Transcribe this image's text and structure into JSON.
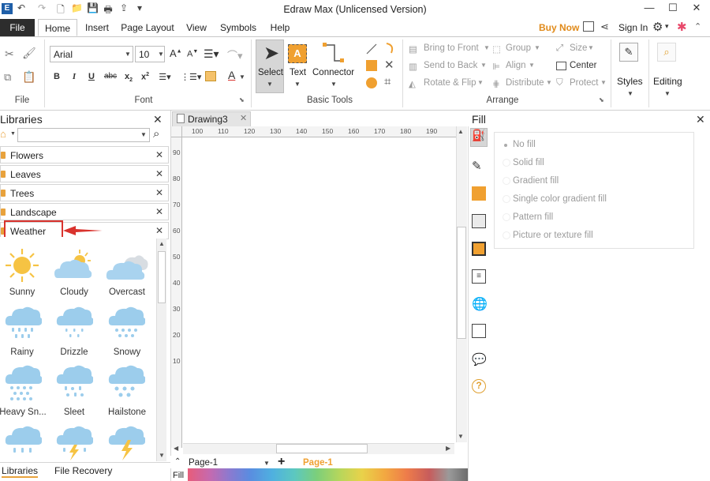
{
  "window": {
    "title": "Edraw Max (Unlicensed Version)",
    "minimize": "—",
    "maximize": "☐",
    "close": "✕"
  },
  "menu": {
    "file": "File",
    "tabs": [
      "Home",
      "Insert",
      "Page Layout",
      "View",
      "Symbols",
      "Help"
    ],
    "active_tab": "Home",
    "buy_now": "Buy Now",
    "sign_in": "Sign In"
  },
  "ribbon": {
    "groups": {
      "file": "File",
      "font": "Font",
      "basic_tools": "Basic Tools",
      "arrange": "Arrange"
    },
    "font_name": "Arial",
    "font_size": "10",
    "tools": {
      "select": "Select",
      "text": "Text",
      "connector": "Connector"
    },
    "arrange": {
      "bring_to_front": "Bring to Front",
      "send_to_back": "Send to Back",
      "rotate_flip": "Rotate & Flip",
      "group": "Group",
      "align": "Align",
      "distribute": "Distribute",
      "size": "Size",
      "center": "Center",
      "protect": "Protect"
    },
    "styles": "Styles",
    "editing": "Editing"
  },
  "libraries": {
    "title": "Libraries",
    "categories": [
      "Flowers",
      "Leaves",
      "Trees",
      "Landscape",
      "Weather"
    ],
    "shapes": [
      "Sunny",
      "Cloudy",
      "Overcast",
      "Rainy",
      "Drizzle",
      "Snowy",
      "Heavy Sn...",
      "Sleet",
      "Hailstone"
    ],
    "bottom_tabs": [
      "Libraries",
      "File Recovery"
    ]
  },
  "document": {
    "tab_name": "Drawing3",
    "ruler_h": [
      "100",
      "110",
      "120",
      "130",
      "140",
      "150",
      "160",
      "170",
      "180",
      "190"
    ],
    "ruler_v": [
      "90",
      "80",
      "70",
      "60",
      "50",
      "40",
      "30",
      "20",
      "10"
    ],
    "page_selector": "Page-1",
    "page_tab": "Page-1",
    "fill_label": "Fill"
  },
  "fill_panel": {
    "title": "Fill",
    "options": [
      "No fill",
      "Solid fill",
      "Gradient fill",
      "Single color gradient fill",
      "Pattern fill",
      "Picture or texture fill"
    ],
    "selected": "No fill"
  },
  "colors": {
    "accent_orange": "#f0a030",
    "highlight_red": "#d9332e",
    "sky_blue": "#8fc8ea",
    "sun_yellow": "#f6c343",
    "buy_now": "#e08a1a"
  }
}
